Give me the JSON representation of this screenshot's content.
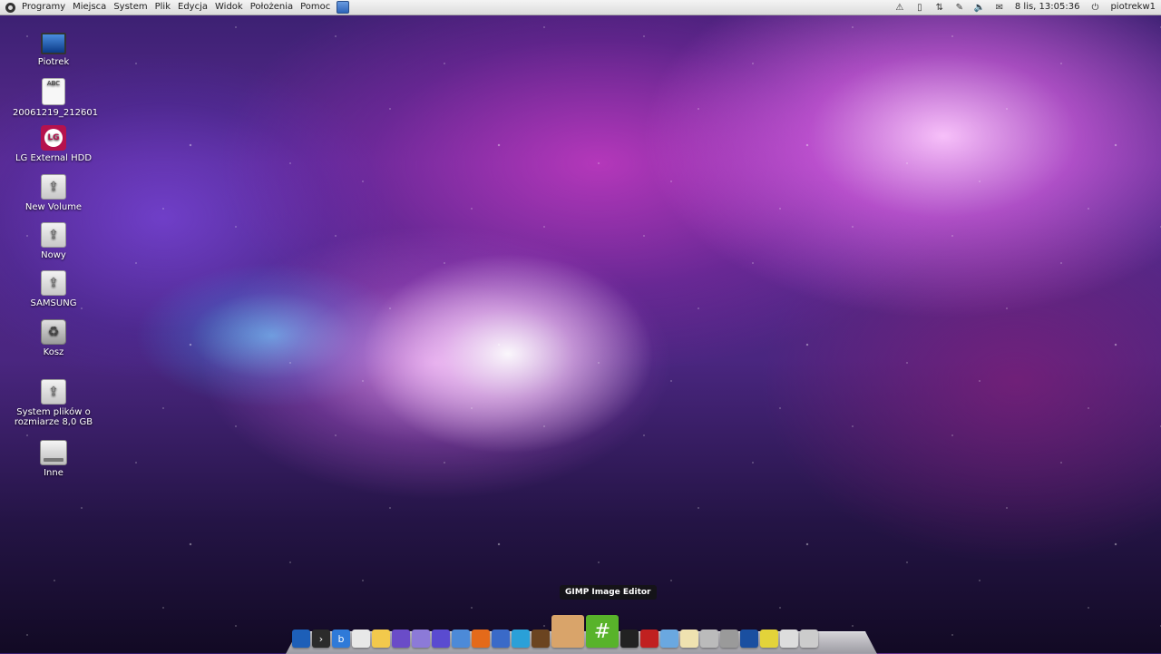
{
  "top_panel": {
    "menus": [
      "Programy",
      "Miejsca",
      "System",
      "Plik",
      "Edycja",
      "Widok",
      "Położenia",
      "Pomoc"
    ],
    "clock": "8 lis, 13:05:36",
    "user": "piotrekw1"
  },
  "desktop": {
    "icons": [
      {
        "label": "Piotrek"
      },
      {
        "label": "20061219_212601"
      },
      {
        "label": "LG External HDD"
      },
      {
        "label": "New Volume"
      },
      {
        "label": "Nowy"
      },
      {
        "label": "SAMSUNG"
      },
      {
        "label": "Kosz"
      },
      {
        "label": "System plików o rozmiarze 8,0 GB"
      },
      {
        "label": "Inne"
      }
    ],
    "doc_icon_text": "ABC"
  },
  "dock": {
    "tooltip": "GIMP Image Editor",
    "items": [
      {
        "name": "monitor-icon",
        "color": "#1d5fb8"
      },
      {
        "name": "terminal-icon",
        "color": "#2b2b2b",
        "glyph": "›"
      },
      {
        "name": "bluefish-icon",
        "color": "#2f7ad8",
        "glyph": "b"
      },
      {
        "name": "text-editor-icon",
        "color": "#e8e8e8"
      },
      {
        "name": "notes-icon",
        "color": "#f2c94c"
      },
      {
        "name": "app-icon-purple",
        "color": "#6a4cc8"
      },
      {
        "name": "app-icon-lavender",
        "color": "#8c7ad8"
      },
      {
        "name": "browser-icon",
        "color": "#5a4bd0"
      },
      {
        "name": "app-icon-blue",
        "color": "#4c8ad8"
      },
      {
        "name": "firefox-icon",
        "color": "#e46a1a"
      },
      {
        "name": "thunderbird-icon",
        "color": "#3a6ac8"
      },
      {
        "name": "app-icon-cyan",
        "color": "#2aa0d8"
      },
      {
        "name": "book-icon",
        "color": "#6b4420"
      },
      {
        "name": "gimp-icon",
        "color": "#d9a46a"
      },
      {
        "name": "hashtag-app-icon",
        "color": "#58b32a",
        "glyph": "#"
      },
      {
        "name": "system-monitor-icon",
        "color": "#222222"
      },
      {
        "name": "record-icon",
        "color": "#c02020"
      },
      {
        "name": "folder-icon",
        "color": "#6aa8e0"
      },
      {
        "name": "document-icon",
        "color": "#efe2b0"
      },
      {
        "name": "device-icon",
        "color": "#bbbbbb"
      },
      {
        "name": "trash-icon",
        "color": "#9a9a9a"
      },
      {
        "name": "screen-icon",
        "color": "#1a4fa0"
      },
      {
        "name": "ball-icon",
        "color": "#e3d33a"
      },
      {
        "name": "mail-icon",
        "color": "#dddddd"
      },
      {
        "name": "clock-icon",
        "color": "#cccccc"
      }
    ]
  }
}
